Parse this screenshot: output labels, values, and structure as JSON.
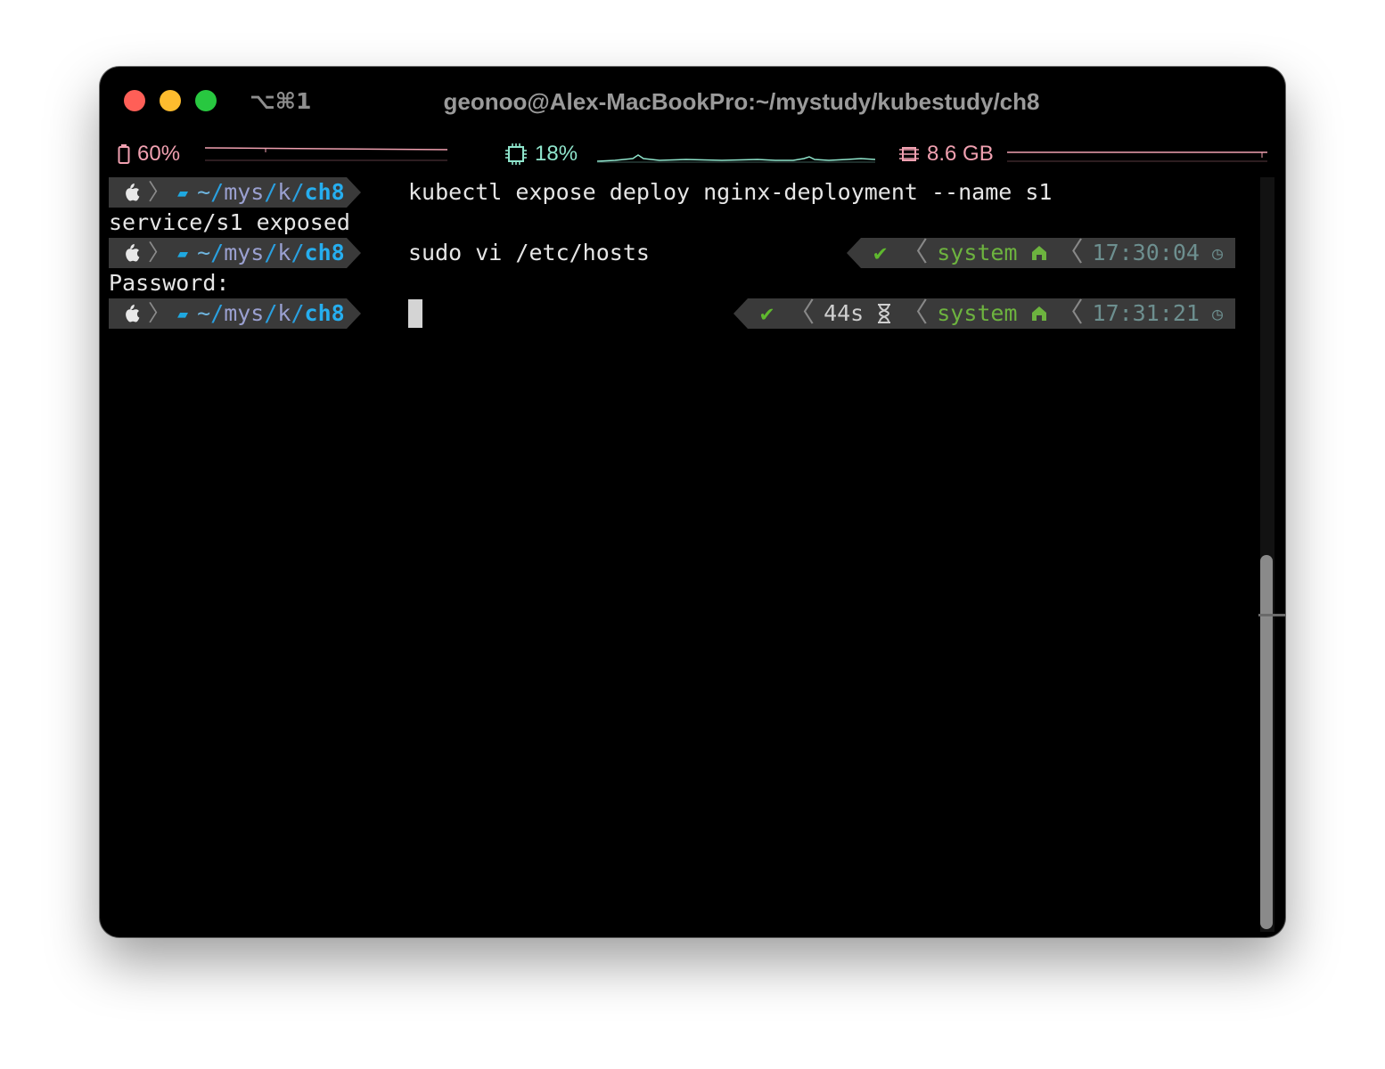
{
  "window": {
    "title": "geonoo@Alex-MacBookPro:~/mystudy/kubestudy/ch8",
    "shortcut": "⌥⌘1"
  },
  "status_bar": {
    "battery": {
      "label": "60%",
      "icon": "battery-icon",
      "color": "#f0a0b0"
    },
    "cpu": {
      "label": "18%",
      "icon": "cpu-chip-icon",
      "color": "#8fe5cc"
    },
    "memory": {
      "label": "8.6 GB",
      "icon": "memory-icon",
      "color": "#f0a0b0"
    }
  },
  "prompt": {
    "os_icon": "apple-icon",
    "folder_icon": "folder-icon",
    "path_home": "~",
    "path_part1": "mys",
    "path_part2": "k",
    "path_current": "ch8"
  },
  "terminal": {
    "line1_command": "kubectl expose deploy nginx-deployment --name s1",
    "line2_output": "service/s1 exposed",
    "line3_command": "sudo vi /etc/hosts",
    "line3_status": {
      "ok": "✔",
      "env": "system",
      "time": "17:30:04"
    },
    "line4_output": "Password:",
    "line5_status": {
      "ok": "✔",
      "duration": "44s",
      "env": "system",
      "time": "17:31:21"
    }
  },
  "colors": {
    "segment_bg": "#3a3a3a",
    "path_accent": "#26aeef",
    "ok_green": "#5fb82e",
    "env_green": "#6db33f"
  }
}
